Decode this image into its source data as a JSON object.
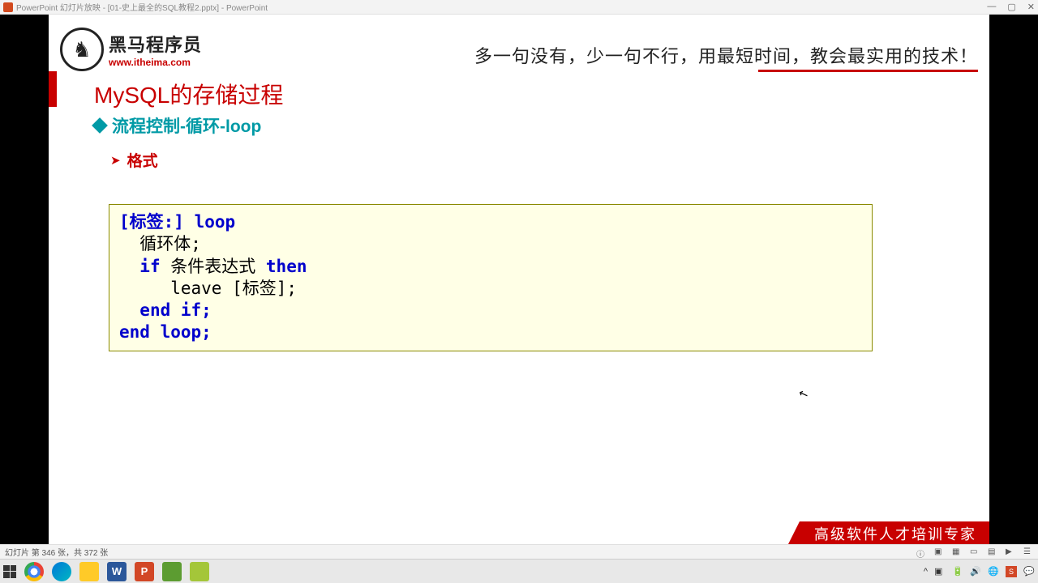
{
  "titlebar": {
    "text": "PowerPoint 幻灯片放映 - [01-史上最全的SQL教程2.pptx] - PowerPoint",
    "controls": {
      "min": "—",
      "max": "▢",
      "close": "✕"
    }
  },
  "slide": {
    "logo_cn": "黑马程序员",
    "logo_url": "www.itheima.com",
    "tagline": "多一句没有，少一句不行，用最短时间，教会最实用的技术！",
    "title": "MySQL的存储过程",
    "subtitle": "流程控制-循环-loop",
    "format_label": "格式",
    "code": {
      "l1a": "[标签:]",
      "l1b": "loop",
      "l2": "循环体;",
      "l3a": "if",
      "l3b": "条件表达式",
      "l3c": "then",
      "l4": "leave [标签];",
      "l5": "end if;",
      "l6": "end loop;"
    },
    "footer": "高级软件人才培训专家"
  },
  "statusbar": {
    "left": "幻灯片 第 346 张，共 372 张"
  },
  "taskbar": {
    "apps": [
      "start",
      "chrome",
      "edge",
      "folder",
      "word",
      "ppt",
      "tool1",
      "tool2"
    ]
  }
}
